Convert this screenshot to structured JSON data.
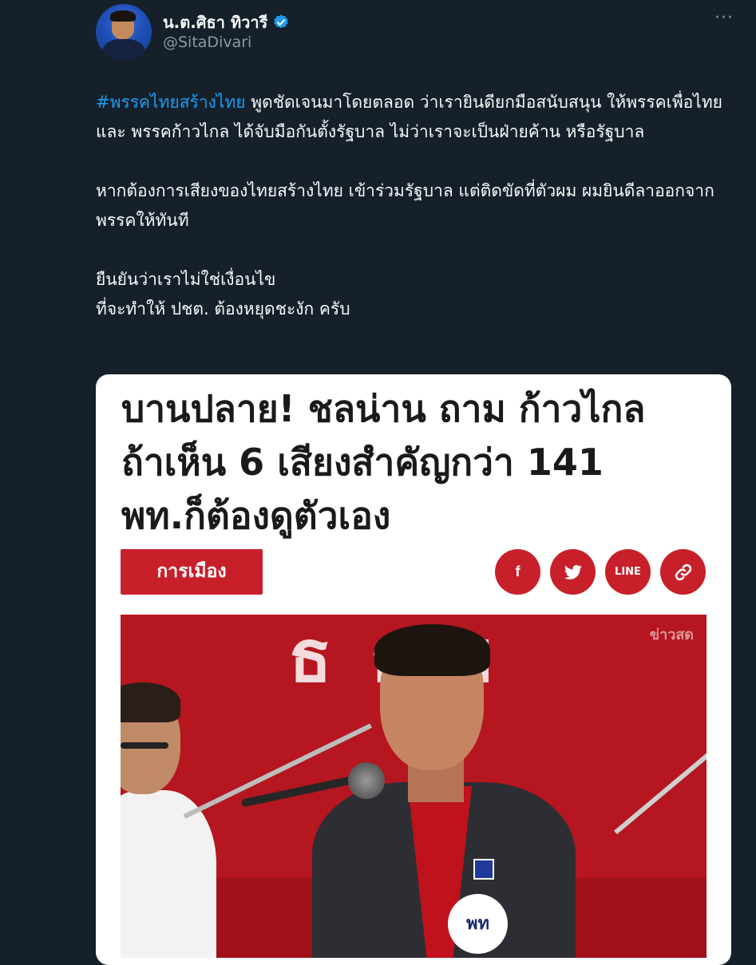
{
  "author": {
    "display_name": "น.ต.ศิธา ทิวารี",
    "handle": "@SitaDivari",
    "verified": true
  },
  "tweet": {
    "hashtag": "#พรรคไทยสร้างไทย",
    "paragraph_1": " พูดชัดเจนมาโดยตลอด ว่าเรายินดียกมือสนับสนุน ให้พรรคเพื่อไทย และ พรรคก้าวไกล ได้จับมือกันตั้งรัฐบาล ไม่ว่าเราจะเป็นฝ่ายค้าน หรือรัฐบาล",
    "paragraph_2": "หากต้องการเสียงของไทยสร้างไทย เข้าร่วมรัฐบาล แต่ติดขัดที่ตัวผม ผมยินดีลาออกจากพรรคให้ทันที",
    "paragraph_3_line_1": "ยืนยันว่าเราไม่ใช่เงื่อนไข",
    "paragraph_3_line_2": "ที่จะทำให้ ปชต. ต้องหยุดชะงัก ครับ"
  },
  "card": {
    "headline_line_1": "บานปลาย! ชลน่าน ถาม ก้าวไกล",
    "headline_line_2": "ถ้าเห็น 6 เสียงสำคัญกว่า 141",
    "headline_line_3": "พท.ก็ต้องดูตัวเอง",
    "category": "การเมือง",
    "share_buttons": {
      "facebook": "f",
      "twitter": "twitter-icon",
      "line": "LINE",
      "link": "link-icon"
    },
    "photo": {
      "backdrop_text": "ธ ธ ฯ",
      "watermark": "ข่าวสด",
      "badge_text": "พท"
    }
  },
  "colors": {
    "background": "#15202b",
    "hashtag": "#1d9bf0",
    "verified": "#1d9bf0",
    "secondary_text": "#8b98a5",
    "card_accent": "#c8202b"
  },
  "icons": [
    "verified-badge-icon",
    "more-options-icon",
    "facebook-icon",
    "twitter-icon",
    "line-icon",
    "link-icon"
  ]
}
